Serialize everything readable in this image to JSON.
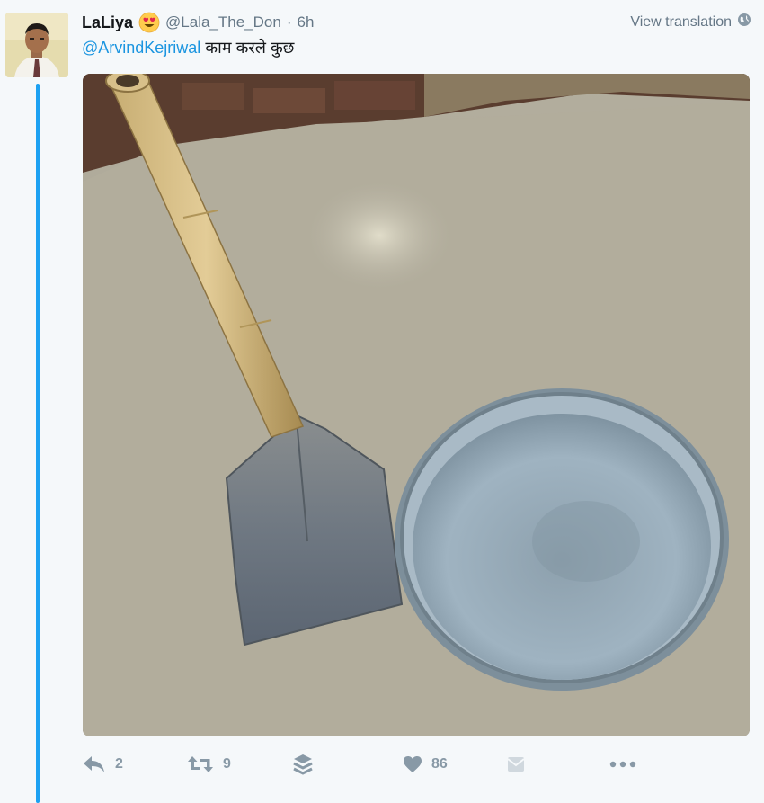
{
  "tweet": {
    "name": "LaLiya",
    "handle": "@Lala_The_Don",
    "separator": "·",
    "time": "6h",
    "view_translation": "View translation",
    "mention": "@ArvindKejriwal",
    "text": " काम करले कुछ"
  },
  "media": {
    "description_icons": [
      "shovel",
      "metal-basin"
    ]
  },
  "actions": {
    "reply_count": "2",
    "retweet_count": "9",
    "like_count": "86"
  },
  "colors": {
    "accent": "#1da1f2",
    "mention": "#1b95e0",
    "action_gray": "#8899a6",
    "background": "#f5f8fa"
  }
}
